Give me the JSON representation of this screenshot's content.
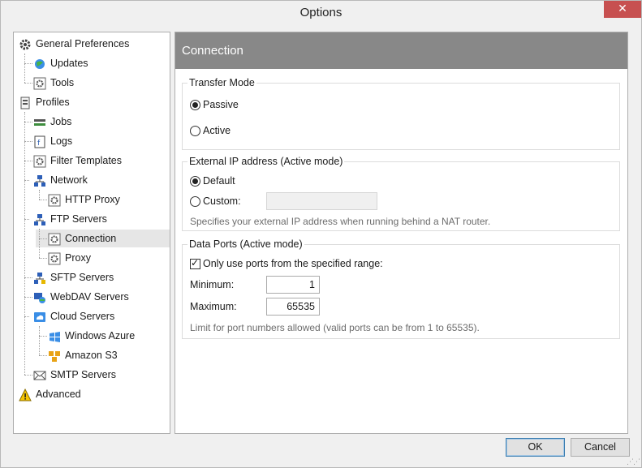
{
  "window": {
    "title": "Options",
    "close_symbol": "✕"
  },
  "tree": {
    "items": [
      {
        "label": "General Preferences",
        "icon": "gear-icon"
      },
      {
        "label": "Updates",
        "icon": "globe-update-icon"
      },
      {
        "label": "Tools",
        "icon": "tools-icon"
      },
      {
        "label": "Profiles",
        "icon": "profiles-icon"
      },
      {
        "label": "Jobs",
        "icon": "jobs-icon"
      },
      {
        "label": "Logs",
        "icon": "log-icon"
      },
      {
        "label": "Filter Templates",
        "icon": "filter-icon"
      },
      {
        "label": "Network",
        "icon": "network-icon"
      },
      {
        "label": "HTTP Proxy",
        "icon": "proxy-icon"
      },
      {
        "label": "FTP Servers",
        "icon": "ftp-server-icon"
      },
      {
        "label": "Connection",
        "icon": "connection-icon"
      },
      {
        "label": "Proxy",
        "icon": "proxy-icon"
      },
      {
        "label": "SFTP Servers",
        "icon": "sftp-server-icon"
      },
      {
        "label": "WebDAV Servers",
        "icon": "webdav-icon"
      },
      {
        "label": "Cloud Servers",
        "icon": "cloud-icon"
      },
      {
        "label": "Windows Azure",
        "icon": "azure-icon"
      },
      {
        "label": "Amazon S3",
        "icon": "amazon-s3-icon"
      },
      {
        "label": "SMTP Servers",
        "icon": "mail-icon"
      },
      {
        "label": "Advanced",
        "icon": "warning-icon"
      }
    ],
    "selected": "Connection"
  },
  "pane": {
    "header": "Connection",
    "transfer_mode": {
      "title": "Transfer Mode",
      "passive": "Passive",
      "active": "Active",
      "selected": "Passive"
    },
    "external_ip": {
      "title": "External IP address (Active mode)",
      "default": "Default",
      "custom": "Custom:",
      "custom_value": "",
      "selected": "Default",
      "hint": "Specifies your external IP address when running behind a NAT router."
    },
    "data_ports": {
      "title": "Data Ports (Active mode)",
      "only_range_label": "Only use ports from the specified range:",
      "only_range_checked": true,
      "minimum_label": "Minimum:",
      "minimum_value": "1",
      "maximum_label": "Maximum:",
      "maximum_value": "65535",
      "hint": "Limit for port numbers allowed (valid ports can be from 1 to 65535)."
    }
  },
  "footer": {
    "ok_label": "OK",
    "cancel_label": "Cancel"
  },
  "colors": {
    "header_bg": "#888888",
    "close_bg": "#c75050",
    "default_btn_border": "#3c7fb1"
  }
}
